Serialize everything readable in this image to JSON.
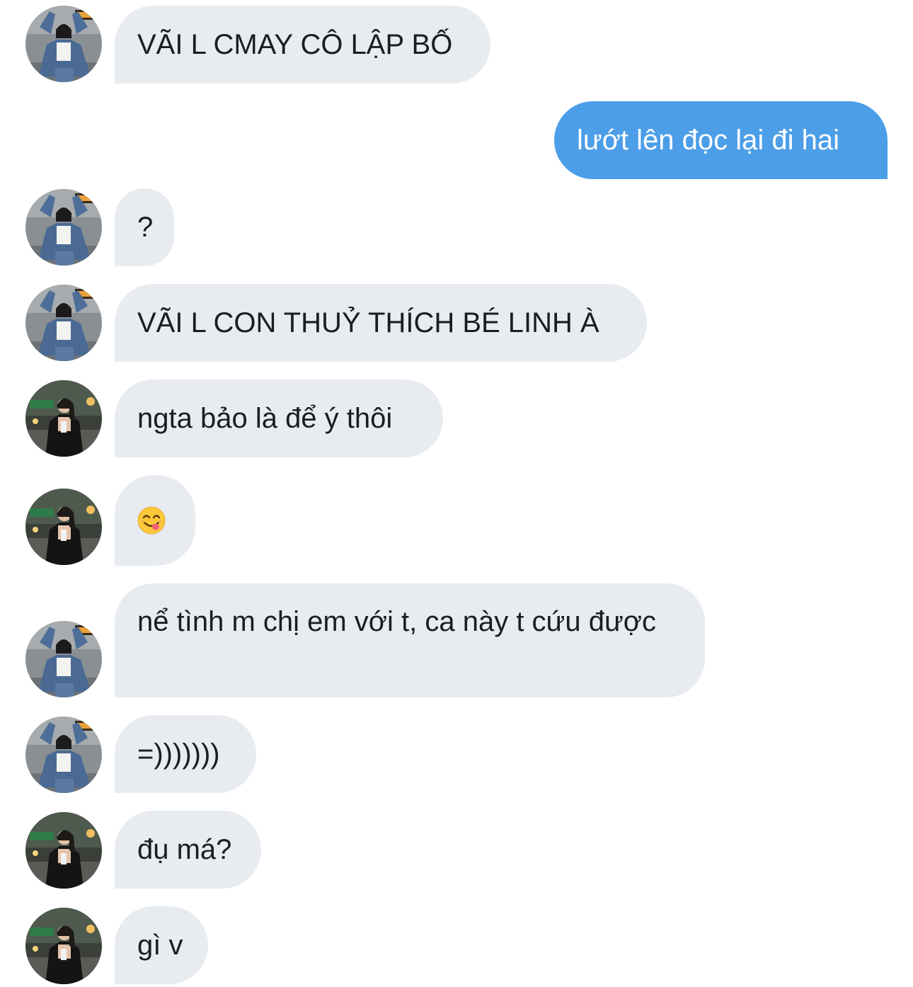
{
  "messages": [
    {
      "text": "VÃI L CMAY CÔ LẬP BỐ",
      "sender": "jacket-girl"
    },
    {
      "text": "lướt lên đọc lại đi hai",
      "sender": "me"
    },
    {
      "text": "?",
      "sender": "jacket-girl"
    },
    {
      "text": "VÃI L CON THUỶ THÍCH BÉ LINH À",
      "sender": "jacket-girl"
    },
    {
      "text": "ngta bảo là để ý thôi",
      "sender": "black-dress-girl"
    },
    {
      "emoji": "yum-face-emoji",
      "sender": "black-dress-girl"
    },
    {
      "text": "nể tình m chị em với t, ca này t cứu được",
      "sender": "jacket-girl"
    },
    {
      "text": "=)))))))",
      "sender": "jacket-girl"
    },
    {
      "text": "đụ má?",
      "sender": "black-dress-girl"
    },
    {
      "text": "gì v",
      "sender": "black-dress-girl"
    }
  ],
  "colors": {
    "incoming_bubble": "#e8ebef",
    "outgoing_bubble": "#4c9ee8",
    "incoming_text": "#1a1d21",
    "outgoing_text": "#ffffff"
  }
}
